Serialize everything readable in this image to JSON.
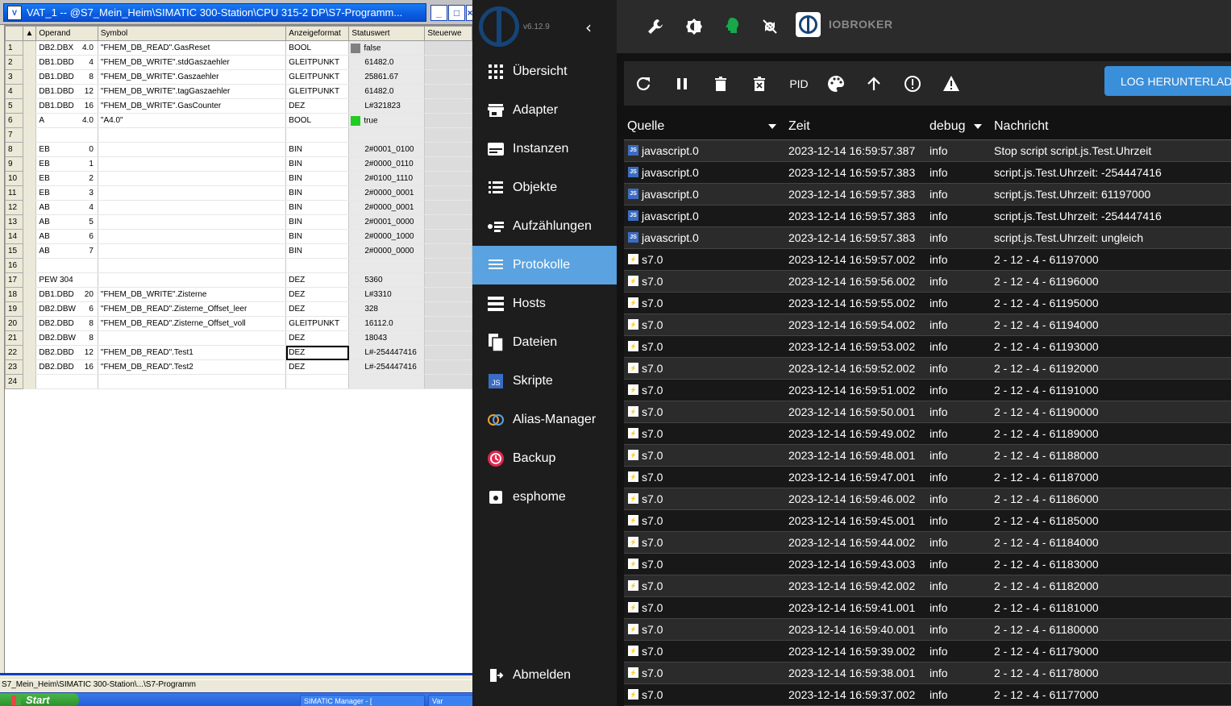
{
  "vat": {
    "title": "VAT_1 -- @S7_Mein_Heim\\SIMATIC 300-Station\\CPU 315-2 DP\\S7-Programm...",
    "window_buttons": [
      "_",
      "□",
      "×"
    ],
    "columns": [
      "Operand",
      "Symbol",
      "Anzeigeformat",
      "Statuswert",
      "Steuerwe"
    ],
    "rows": [
      {
        "n": "1",
        "operand": "DB2.DBX",
        "addr": "4.0",
        "symbol": "\"FHEM_DB_READ\".GasReset",
        "format": "BOOL",
        "status": "false",
        "lamp": "#808080"
      },
      {
        "n": "2",
        "operand": "DB1.DBD",
        "addr": "4",
        "symbol": "\"FHEM_DB_WRITE\".stdGaszaehler",
        "format": "GLEITPUNKT",
        "status": "61482.0",
        "lamp": ""
      },
      {
        "n": "3",
        "operand": "DB1.DBD",
        "addr": "8",
        "symbol": "\"FHEM_DB_WRITE\".Gaszaehler",
        "format": "GLEITPUNKT",
        "status": "25861.67",
        "lamp": ""
      },
      {
        "n": "4",
        "operand": "DB1.DBD",
        "addr": "12",
        "symbol": "\"FHEM_DB_WRITE\".tagGaszaehler",
        "format": "GLEITPUNKT",
        "status": "61482.0",
        "lamp": ""
      },
      {
        "n": "5",
        "operand": "DB1.DBD",
        "addr": "16",
        "symbol": "\"FHEM_DB_WRITE\".GasCounter",
        "format": "DEZ",
        "status": "L#321823",
        "lamp": ""
      },
      {
        "n": "6",
        "operand": "A",
        "addr": "4.0",
        "symbol": "\"A4.0\"",
        "format": "BOOL",
        "status": "true",
        "lamp": "#22cc22"
      },
      {
        "n": "7",
        "operand": "",
        "addr": "",
        "symbol": "",
        "format": "",
        "status": "",
        "lamp": ""
      },
      {
        "n": "8",
        "operand": "EB",
        "addr": "0",
        "symbol": "",
        "format": "BIN",
        "status": "2#0001_0100",
        "lamp": ""
      },
      {
        "n": "9",
        "operand": "EB",
        "addr": "1",
        "symbol": "",
        "format": "BIN",
        "status": "2#0000_0110",
        "lamp": ""
      },
      {
        "n": "10",
        "operand": "EB",
        "addr": "2",
        "symbol": "",
        "format": "BIN",
        "status": "2#0100_1110",
        "lamp": ""
      },
      {
        "n": "11",
        "operand": "EB",
        "addr": "3",
        "symbol": "",
        "format": "BIN",
        "status": "2#0000_0001",
        "lamp": ""
      },
      {
        "n": "12",
        "operand": "AB",
        "addr": "4",
        "symbol": "",
        "format": "BIN",
        "status": "2#0000_0001",
        "lamp": ""
      },
      {
        "n": "13",
        "operand": "AB",
        "addr": "5",
        "symbol": "",
        "format": "BIN",
        "status": "2#0001_0000",
        "lamp": ""
      },
      {
        "n": "14",
        "operand": "AB",
        "addr": "6",
        "symbol": "",
        "format": "BIN",
        "status": "2#0000_1000",
        "lamp": ""
      },
      {
        "n": "15",
        "operand": "AB",
        "addr": "7",
        "symbol": "",
        "format": "BIN",
        "status": "2#0000_0000",
        "lamp": ""
      },
      {
        "n": "16",
        "operand": "",
        "addr": "",
        "symbol": "",
        "format": "",
        "status": "",
        "lamp": ""
      },
      {
        "n": "17",
        "operand": "PEW 304",
        "addr": "",
        "symbol": "",
        "format": "DEZ",
        "status": "5360",
        "lamp": ""
      },
      {
        "n": "18",
        "operand": "DB1.DBD",
        "addr": "20",
        "symbol": "\"FHEM_DB_WRITE\".Zisterne",
        "format": "DEZ",
        "status": "L#3310",
        "lamp": ""
      },
      {
        "n": "19",
        "operand": "DB2.DBW",
        "addr": "6",
        "symbol": "\"FHEM_DB_READ\".Zisterne_Offset_leer",
        "format": "DEZ",
        "status": "328",
        "lamp": ""
      },
      {
        "n": "20",
        "operand": "DB2.DBD",
        "addr": "8",
        "symbol": "\"FHEM_DB_READ\".Zisterne_Offset_voll",
        "format": "GLEITPUNKT",
        "status": "16112.0",
        "lamp": ""
      },
      {
        "n": "21",
        "operand": "DB2.DBW",
        "addr": "8",
        "symbol": "",
        "format": "DEZ",
        "status": "18043",
        "lamp": ""
      },
      {
        "n": "22",
        "operand": "DB2.DBD",
        "addr": "12",
        "symbol": "\"FHEM_DB_READ\".Test1",
        "format": "DEZ",
        "status": "L#-254447416",
        "lamp": "",
        "selected": true
      },
      {
        "n": "23",
        "operand": "DB2.DBD",
        "addr": "16",
        "symbol": "\"FHEM_DB_READ\".Test2",
        "format": "DEZ",
        "status": "L#-254447416",
        "lamp": ""
      },
      {
        "n": "24",
        "operand": "",
        "addr": "",
        "symbol": "",
        "format": "",
        "status": "",
        "lamp": ""
      }
    ],
    "statusbar": "S7_Mein_Heim\\SIMATIC 300-Station\\...\\S7-Programm",
    "taskbar": {
      "start": "Start",
      "tasks": [
        "SIMATIC Manager - [",
        "Var"
      ]
    }
  },
  "iobroker": {
    "version": "v6.12.9",
    "brand": "IOBROKER",
    "colors": {
      "active_nav": "#5aa2e0",
      "accent_button": "#3a8fdb"
    },
    "nav": [
      {
        "label": "Übersicht",
        "icon": "grid-icon"
      },
      {
        "label": "Adapter",
        "icon": "store-icon"
      },
      {
        "label": "Instanzen",
        "icon": "instances-icon"
      },
      {
        "label": "Objekte",
        "icon": "list-icon"
      },
      {
        "label": "Aufzählungen",
        "icon": "enum-icon"
      },
      {
        "label": "Protokolle",
        "icon": "log-icon",
        "active": true
      },
      {
        "label": "Hosts",
        "icon": "hosts-icon"
      },
      {
        "label": "Dateien",
        "icon": "files-icon"
      },
      {
        "label": "Skripte",
        "icon": "js-icon"
      },
      {
        "label": "Alias-Manager",
        "icon": "alias-icon"
      },
      {
        "label": "Backup",
        "icon": "backup-icon"
      },
      {
        "label": "esphome",
        "icon": "esphome-icon"
      }
    ],
    "logout": "Abmelden",
    "log_toolbar": {
      "pid_label": "PID",
      "download_label": "LOG HERUNTERLADEN"
    },
    "log_columns": {
      "source": "Quelle",
      "time": "Zeit",
      "level": "debug",
      "message": "Nachricht"
    },
    "log_rows": [
      {
        "source": "javascript.0",
        "type": "js",
        "time": "2023-12-14 16:59:57.387",
        "level": "info",
        "message": "Stop script script.js.Test.Uhrzeit"
      },
      {
        "source": "javascript.0",
        "type": "js",
        "time": "2023-12-14 16:59:57.383",
        "level": "info",
        "message": "script.js.Test.Uhrzeit: -254447416"
      },
      {
        "source": "javascript.0",
        "type": "js",
        "time": "2023-12-14 16:59:57.383",
        "level": "info",
        "message": "script.js.Test.Uhrzeit: 61197000"
      },
      {
        "source": "javascript.0",
        "type": "js",
        "time": "2023-12-14 16:59:57.383",
        "level": "info",
        "message": "script.js.Test.Uhrzeit: -254447416"
      },
      {
        "source": "javascript.0",
        "type": "js",
        "time": "2023-12-14 16:59:57.383",
        "level": "info",
        "message": "script.js.Test.Uhrzeit: ungleich"
      },
      {
        "source": "s7.0",
        "type": "s7",
        "time": "2023-12-14 16:59:57.002",
        "level": "info",
        "message": "2 - 12 - 4 - 61197000"
      },
      {
        "source": "s7.0",
        "type": "s7",
        "time": "2023-12-14 16:59:56.002",
        "level": "info",
        "message": "2 - 12 - 4 - 61196000"
      },
      {
        "source": "s7.0",
        "type": "s7",
        "time": "2023-12-14 16:59:55.002",
        "level": "info",
        "message": "2 - 12 - 4 - 61195000"
      },
      {
        "source": "s7.0",
        "type": "s7",
        "time": "2023-12-14 16:59:54.002",
        "level": "info",
        "message": "2 - 12 - 4 - 61194000"
      },
      {
        "source": "s7.0",
        "type": "s7",
        "time": "2023-12-14 16:59:53.002",
        "level": "info",
        "message": "2 - 12 - 4 - 61193000"
      },
      {
        "source": "s7.0",
        "type": "s7",
        "time": "2023-12-14 16:59:52.002",
        "level": "info",
        "message": "2 - 12 - 4 - 61192000"
      },
      {
        "source": "s7.0",
        "type": "s7",
        "time": "2023-12-14 16:59:51.002",
        "level": "info",
        "message": "2 - 12 - 4 - 61191000"
      },
      {
        "source": "s7.0",
        "type": "s7",
        "time": "2023-12-14 16:59:50.001",
        "level": "info",
        "message": "2 - 12 - 4 - 61190000"
      },
      {
        "source": "s7.0",
        "type": "s7",
        "time": "2023-12-14 16:59:49.002",
        "level": "info",
        "message": "2 - 12 - 4 - 61189000"
      },
      {
        "source": "s7.0",
        "type": "s7",
        "time": "2023-12-14 16:59:48.001",
        "level": "info",
        "message": "2 - 12 - 4 - 61188000"
      },
      {
        "source": "s7.0",
        "type": "s7",
        "time": "2023-12-14 16:59:47.001",
        "level": "info",
        "message": "2 - 12 - 4 - 61187000"
      },
      {
        "source": "s7.0",
        "type": "s7",
        "time": "2023-12-14 16:59:46.002",
        "level": "info",
        "message": "2 - 12 - 4 - 61186000"
      },
      {
        "source": "s7.0",
        "type": "s7",
        "time": "2023-12-14 16:59:45.001",
        "level": "info",
        "message": "2 - 12 - 4 - 61185000"
      },
      {
        "source": "s7.0",
        "type": "s7",
        "time": "2023-12-14 16:59:44.002",
        "level": "info",
        "message": "2 - 12 - 4 - 61184000"
      },
      {
        "source": "s7.0",
        "type": "s7",
        "time": "2023-12-14 16:59:43.003",
        "level": "info",
        "message": "2 - 12 - 4 - 61183000"
      },
      {
        "source": "s7.0",
        "type": "s7",
        "time": "2023-12-14 16:59:42.002",
        "level": "info",
        "message": "2 - 12 - 4 - 61182000"
      },
      {
        "source": "s7.0",
        "type": "s7",
        "time": "2023-12-14 16:59:41.001",
        "level": "info",
        "message": "2 - 12 - 4 - 61181000"
      },
      {
        "source": "s7.0",
        "type": "s7",
        "time": "2023-12-14 16:59:40.001",
        "level": "info",
        "message": "2 - 12 - 4 - 61180000"
      },
      {
        "source": "s7.0",
        "type": "s7",
        "time": "2023-12-14 16:59:39.002",
        "level": "info",
        "message": "2 - 12 - 4 - 61179000"
      },
      {
        "source": "s7.0",
        "type": "s7",
        "time": "2023-12-14 16:59:38.001",
        "level": "info",
        "message": "2 - 12 - 4 - 61178000"
      },
      {
        "source": "s7.0",
        "type": "s7",
        "time": "2023-12-14 16:59:37.002",
        "level": "info",
        "message": "2 - 12 - 4 - 61177000"
      }
    ]
  }
}
